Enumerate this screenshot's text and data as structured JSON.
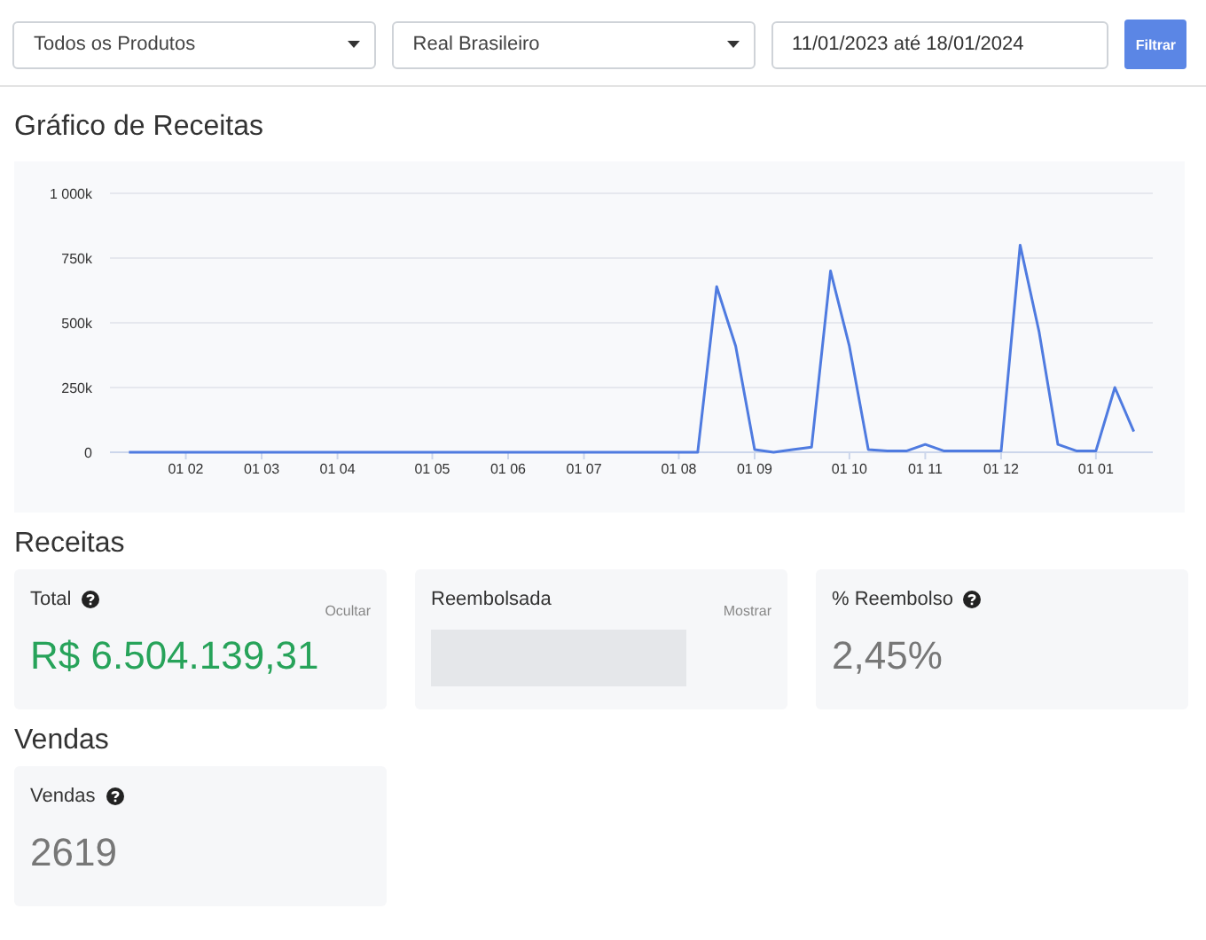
{
  "filters": {
    "product_select": {
      "value": "Todos os Produtos"
    },
    "currency_select": {
      "value": "Real Brasileiro"
    },
    "date_range": {
      "value": "11/01/2023 até 18/01/2024"
    },
    "filter_button": {
      "label": "Filtrar"
    }
  },
  "revenue_chart": {
    "title": "Gráfico de Receitas",
    "chart_data": {
      "type": "line",
      "categories": [
        null,
        null,
        null,
        "01 02",
        null,
        null,
        null,
        "01 03",
        null,
        null,
        null,
        "01 04",
        null,
        null,
        null,
        null,
        "01 05",
        null,
        null,
        null,
        "01 06",
        null,
        null,
        null,
        "01 07",
        null,
        null,
        null,
        null,
        "01 08",
        null,
        null,
        null,
        "01 09",
        null,
        null,
        null,
        null,
        "01 10",
        null,
        null,
        null,
        "01 11",
        null,
        null,
        null,
        "01 12",
        null,
        null,
        null,
        null,
        "01 01",
        null,
        null
      ],
      "series": [
        {
          "color": "#4f7be0",
          "values": [
            0,
            0,
            0,
            0,
            0,
            0,
            0,
            0,
            0,
            0,
            0,
            0,
            0,
            0,
            0,
            0,
            0,
            0,
            0,
            0,
            0,
            0,
            0,
            0,
            0,
            0,
            0,
            0,
            0,
            0,
            0,
            640000,
            410000,
            10000,
            0,
            10000,
            20000,
            700000,
            410000,
            10000,
            5000,
            5000,
            30000,
            5000,
            5000,
            5000,
            5000,
            800000,
            465000,
            30000,
            5000,
            5000,
            250000,
            80000
          ]
        }
      ],
      "grid": true,
      "ylim": [
        0,
        1000000
      ],
      "yticks": [
        {
          "value": 0,
          "label": "0"
        },
        {
          "value": 250000,
          "label": "250k"
        },
        {
          "value": 500000,
          "label": "500k"
        },
        {
          "value": 750000,
          "label": "750k"
        },
        {
          "value": 1000000,
          "label": "1 000k"
        }
      ]
    }
  },
  "revenue": {
    "title": "Receitas",
    "cards": [
      {
        "kind": "positive",
        "label": "Total",
        "help": true,
        "toggle": "Ocultar",
        "value": "R$ 6.504.139,31"
      },
      {
        "kind": "hidden",
        "label": "Reembolsada",
        "help": false,
        "toggle": "Mostrar"
      },
      {
        "kind": "neutral",
        "label": "% Reembolso",
        "help": true,
        "value": "2,45%"
      }
    ]
  },
  "sales": {
    "title": "Vendas",
    "cards": [
      {
        "kind": "neutral",
        "label": "Vendas",
        "help": true,
        "value": "2619"
      }
    ]
  }
}
